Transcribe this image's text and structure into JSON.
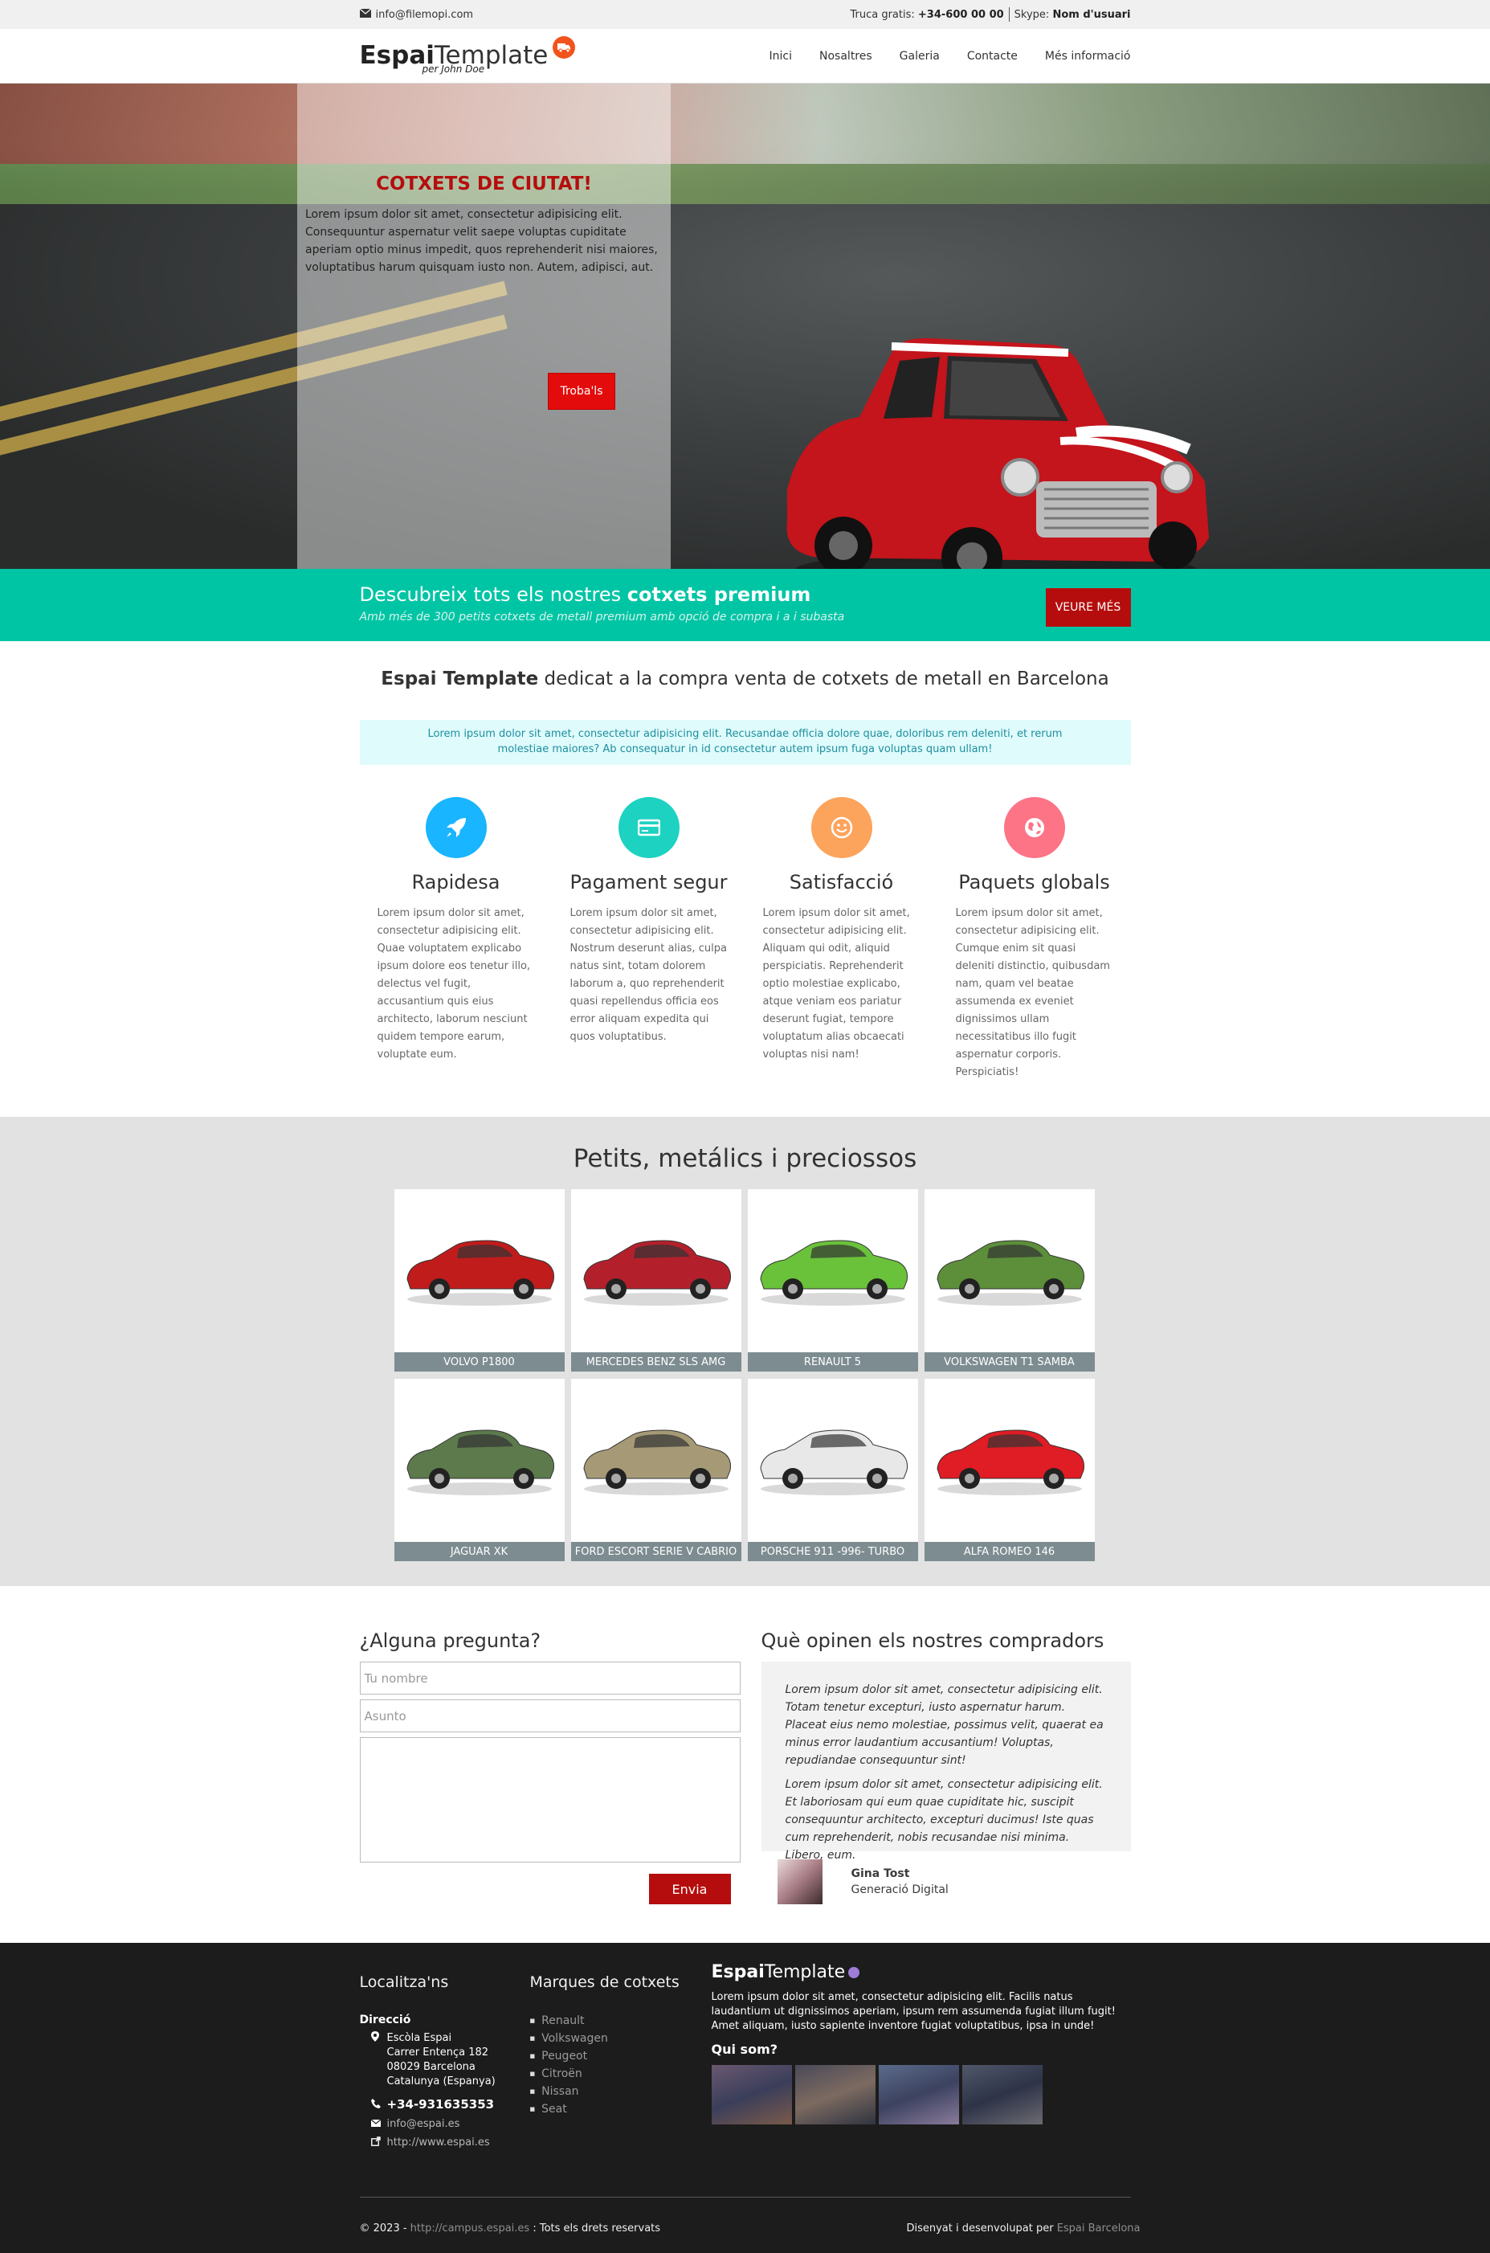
{
  "topbar": {
    "email": "info@filemopi.com",
    "call_label": "Truca gratis:",
    "phone": "+34-600 00 00",
    "skype_label": "Skype:",
    "skype_user": "Nom d'usuari"
  },
  "header": {
    "logo_bold": "Espai",
    "logo_light": "Template",
    "logo_by": "per John Doe",
    "nav": [
      "Inici",
      "Nosaltres",
      "Galeria",
      "Contacte",
      "Més informació"
    ]
  },
  "hero": {
    "title": "COTXETS DE CIUTAT!",
    "text": "Lorem ipsum dolor sit amet, consectetur adipisicing elit. Consequuntur aspernatur velit saepe voluptas cupiditate aperiam optio minus impedit, quos reprehenderit nisi maiores, voluptatibus harum quisquam iusto non. Autem, adipisci, aut.",
    "button": "Troba'ls"
  },
  "premium": {
    "title_start": "Descubreix tots els nostres ",
    "title_bold": "cotxets premium",
    "subtitle": "Amb més de 300 petits cotxets de metall premium amb opció de compra i a i subasta",
    "button": "VEURE MÉS"
  },
  "intro": {
    "heading_bold": "Espai Template",
    "heading_rest": " dedicat a la compra venta de cotxets de metall en Barcelona",
    "note": "Lorem ipsum dolor sit amet, consectetur adipisicing elit. Recusandae officia dolore quae, doloribus rem deleniti, et rerum molestiae maiores? Ab consequatur in id consectetur autem ipsum fuga voluptas quam ullam!"
  },
  "features": [
    {
      "title": "Rapidesa",
      "icon": "rocket-icon",
      "color": "#19b5fe",
      "text": "Lorem ipsum dolor sit amet, consectetur adipisicing elit. Quae voluptatem explicabo ipsum dolore eos tenetur illo, delectus vel fugit, accusantium quis eius architecto, laborum nesciunt quidem tempore earum, voluptate eum."
    },
    {
      "title": "Pagament segur",
      "icon": "credit-card-icon",
      "color": "#1dd2c1",
      "text": "Lorem ipsum dolor sit amet, consectetur adipisicing elit. Nostrum deserunt alias, culpa natus sint, totam dolorem laborum a, quo reprehenderit quasi repellendus officia eos error aliquam expedita qui quos voluptatibus."
    },
    {
      "title": "Satisfacció",
      "icon": "smile-icon",
      "color": "#fca45c",
      "text": "Lorem ipsum dolor sit amet, consectetur adipisicing elit. Aliquam qui odit, aliquid perspiciatis. Reprehenderit optio molestiae explicabo, atque veniam eos pariatur deserunt fugiat, tempore voluptatum alias obcaecati voluptas nisi nam!"
    },
    {
      "title": "Paquets globals",
      "icon": "globe-icon",
      "color": "#fc7486",
      "text": "Lorem ipsum dolor sit amet, consectetur adipisicing elit. Cumque enim sit quasi deleniti distinctio, quibusdam nam, quam vel beatae assumenda ex eveniet dignissimos ullam necessitatibus illo fugit aspernatur corporis. Perspiciatis!"
    }
  ],
  "gallery": {
    "title": "Petits, metálics i preciossos",
    "items": [
      {
        "name": "VOLVO P1800",
        "color": "#c01c1c"
      },
      {
        "name": "MERCEDES BENZ SLS AMG",
        "color": "#b3202c"
      },
      {
        "name": "RENAULT 5",
        "color": "#6ac23a"
      },
      {
        "name": "VOLKSWAGEN T1 SAMBA",
        "color": "#5d8f3a"
      },
      {
        "name": "JAGUAR XK",
        "color": "#5c7a4c"
      },
      {
        "name": "FORD ESCORT SERIE V CABRIO",
        "color": "#a69a76"
      },
      {
        "name": "PORSCHE 911 -996- TURBO",
        "color": "#e8e8e8"
      },
      {
        "name": "ALFA ROMEO 146",
        "color": "#e01c24"
      }
    ]
  },
  "contact": {
    "title": "¿Alguna pregunta?",
    "name_placeholder": "Tu nombre",
    "subject_placeholder": "Asunto",
    "send": "Envia"
  },
  "testimonials": {
    "title": "Què opinen els nostres compradors",
    "p1": "Lorem ipsum dolor sit amet, consectetur adipisicing elit. Totam tenetur excepturi, iusto aspernatur harum. Placeat eius nemo molestiae, possimus velit, quaerat ea minus error laudantium accusantium! Voluptas, repudiandae consequuntur sint!",
    "p2": "Lorem ipsum dolor sit amet, consectetur adipisicing elit. Et laboriosam qui eum quae cupiditate hic, suscipit consequuntur architecto, excepturi ducimus! Iste quas cum reprehenderit, nobis recusandae nisi minima. Libero, eum.",
    "author": "Gina Tost",
    "role": "Generació Digital"
  },
  "footer": {
    "locate_title": "Localitza'ns",
    "dir_label": "Direcció",
    "address": [
      "Escòla Espai",
      "Carrer Entença 182",
      "08029 Barcelona",
      "Catalunya (Espanya)"
    ],
    "phone": "+34-931635353",
    "email": "info@espai.es",
    "web": "http://www.espai.es",
    "brands_title": "Marques de cotxets",
    "brands": [
      "Renault",
      "Volkswagen",
      "Peugeot",
      "Citroën",
      "Nissan",
      "Seat"
    ],
    "logo_bold": "Espai",
    "logo_light": "Template",
    "about": "Lorem ipsum dolor sit amet, consectetur adipisicing elit. Facilis natus laudantium ut dignissimos aperiam, ipsum rem assumenda fugiat illum fugit! Amet aliquam, iusto sapiente inventore fugiat voluptatibus, ipsa in unde!",
    "who_title": "Qui som?",
    "copyright_pre": "© 2023  - ",
    "copyright_link": "http://campus.espai.es",
    "copyright_post": " : Tots els drets reservats",
    "credit_pre": "Disenyat i desenvolupat per ",
    "credit_link": "Espai Barcelona"
  }
}
